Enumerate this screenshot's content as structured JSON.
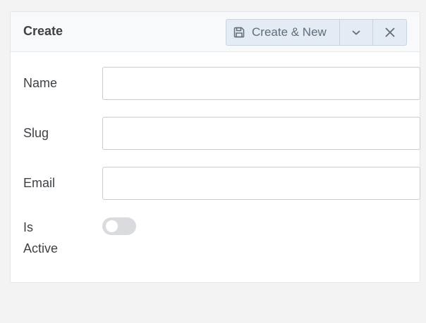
{
  "header": {
    "title": "Create",
    "create_new_label": "Create & New",
    "icons": {
      "save": "save-icon",
      "caret": "chevron-down-icon",
      "close": "close-icon"
    }
  },
  "form": {
    "name_label": "Name",
    "name_value": "",
    "slug_label": "Slug",
    "slug_value": "",
    "email_label": "Email",
    "email_value": "",
    "active_label_line1": "Is",
    "active_label_line2": "Active",
    "is_active": false
  },
  "colors": {
    "page_bg": "#f3f3f3",
    "button_bg": "#e4ebf4",
    "button_text": "#5f6d7c",
    "toggle_off": "#d9dbde"
  }
}
